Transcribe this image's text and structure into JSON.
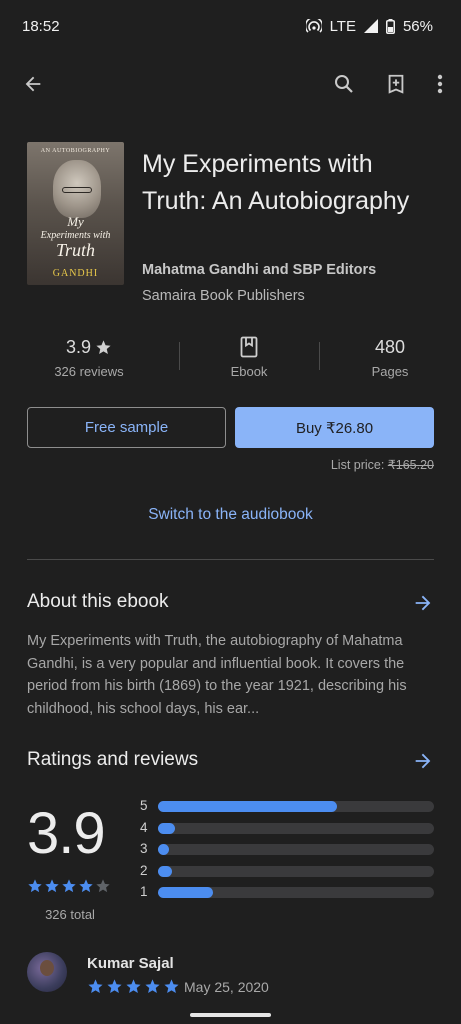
{
  "status": {
    "time": "18:52",
    "network": "LTE",
    "battery": "56%"
  },
  "appbar": {
    "back_icon": "arrow-left-icon",
    "search_icon": "search-icon",
    "wishlist_icon": "bookmark-add-icon",
    "more_icon": "more-vert-icon"
  },
  "book": {
    "cover": {
      "top_text": "AN AUTOBIOGRAPHY",
      "line1": "My",
      "line2": "Experiments with",
      "line3": "Truth",
      "author": "GANDHI"
    },
    "title": "My Experiments with Truth: An Autobiography",
    "author": "Mahatma Gandhi and SBP Editors",
    "publisher": "Samaira Book Publishers"
  },
  "stats": {
    "rating": "3.9",
    "reviews_label": "326 reviews",
    "format_label": "Ebook",
    "pages_value": "480",
    "pages_label": "Pages"
  },
  "actions": {
    "sample_label": "Free sample",
    "buy_label": "Buy ₹26.80",
    "list_price_prefix": "List price: ",
    "list_price_value": "₹165.20",
    "switch_label": "Switch to the audiobook"
  },
  "about": {
    "title": "About this ebook",
    "text": "My Experiments with Truth, the autobiography of Mahatma Gandhi, is a very popular and influential book. It covers the period from his birth (1869) to the year 1921, describing his childhood, his school days, his ear..."
  },
  "ratings": {
    "title": "Ratings and reviews",
    "average": "3.9",
    "average_stars": 4,
    "total_label": "326 total",
    "distribution": [
      {
        "label": "5",
        "fraction": 0.65
      },
      {
        "label": "4",
        "fraction": 0.06
      },
      {
        "label": "3",
        "fraction": 0.04
      },
      {
        "label": "2",
        "fraction": 0.05
      },
      {
        "label": "1",
        "fraction": 0.2
      }
    ]
  },
  "review": {
    "name": "Kumar Sajal",
    "stars": 5,
    "date": "May 25, 2020"
  },
  "colors": {
    "accent": "#8ab4f8",
    "bar": "#4c8df0",
    "background": "#1f1f1f"
  }
}
